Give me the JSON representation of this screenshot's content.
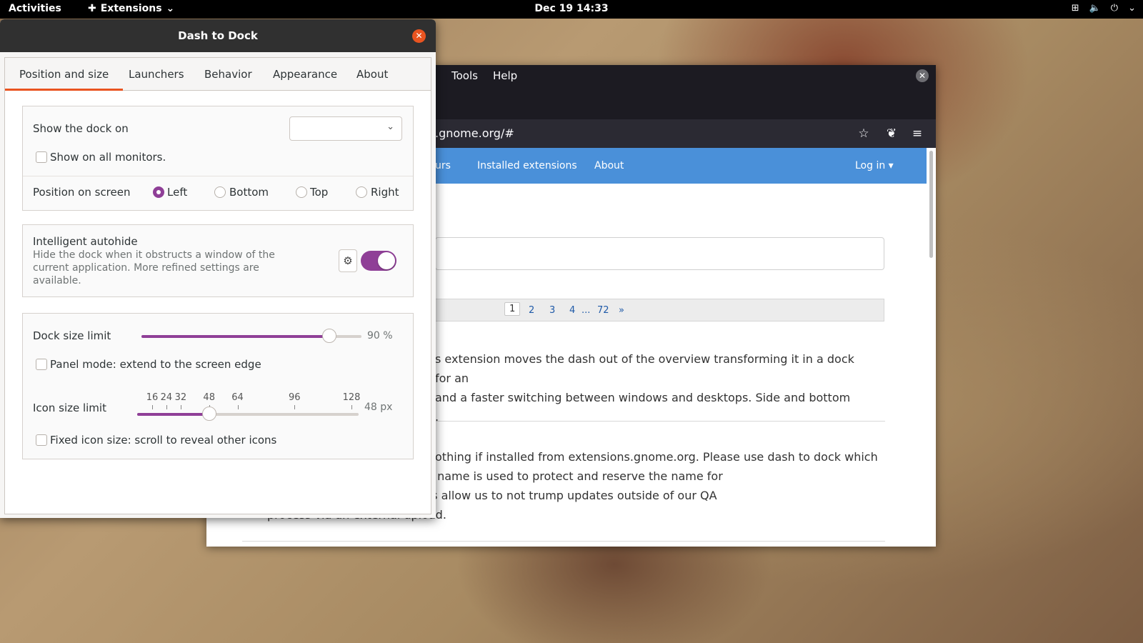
{
  "topbar": {
    "activities": "Activities",
    "extensions_menu": "Extensions",
    "clock": "Dec 19  14:33"
  },
  "browser": {
    "menu": [
      "Tools",
      "Help"
    ],
    "url": ".gnome.org/#",
    "nav": [
      "urs",
      "Installed extensions",
      "About",
      "Log in ▾"
    ],
    "pager": {
      "current": "1",
      "pages": [
        "2",
        "3",
        "4",
        "...",
        "72",
        "»"
      ]
    },
    "para1": "s extension moves the dash out of the overview transforming it in a dock for an\n and a faster switching between windows and desktops. Side and bottom\n.",
    "para2": "othing if installed from extensions.gnome.org. Please use dash to dock which\ns with different defaults. This name is used to protect and reserve the name for\nem extension on ubuntu. This allow us to not trump updates outside of our QA\nprocess via an external upload."
  },
  "dialog": {
    "title": "Dash to Dock",
    "tabs": [
      "Position and size",
      "Launchers",
      "Behavior",
      "Appearance",
      "About"
    ],
    "show_dock_on": "Show the dock on",
    "show_dock_value": "",
    "show_all_monitors": "Show on all monitors.",
    "position_label": "Position on screen",
    "positions": [
      "Left",
      "Bottom",
      "Top",
      "Right"
    ],
    "selected_position": "Left",
    "autohide_title": "Intelligent autohide",
    "autohide_desc": "Hide the dock when it obstructs a window of the current application. More refined settings are available.",
    "autohide_on": true,
    "dock_size_label": "Dock size limit",
    "dock_size_value": "90 %",
    "dock_size_fraction": 0.9,
    "panel_mode": "Panel mode: extend to the screen edge",
    "icon_size_label": "Icon size limit",
    "icon_size_marks": [
      "16",
      "24",
      "32",
      "48",
      "64",
      "96",
      "128"
    ],
    "icon_size_value": "48 px",
    "fixed_icon": "Fixed icon size: scroll to reveal other icons"
  },
  "colors": {
    "accent": "#e95420",
    "switch": "#8f3f97",
    "nav": "#4a90d9"
  }
}
